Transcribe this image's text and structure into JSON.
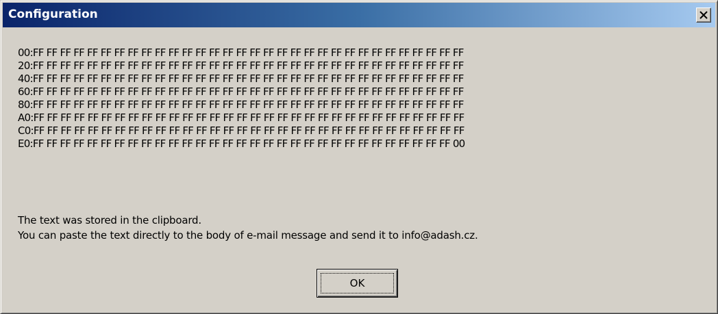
{
  "window": {
    "title": "Configuration",
    "close_symbol": "close-icon"
  },
  "hex_dump": {
    "rows": [
      "00:FF FF FF FF FF FF FF FF FF FF FF FF FF FF FF FF FF FF FF FF FF FF FF FF FF FF FF FF FF FF FF FF",
      "20:FF FF FF FF FF FF FF FF FF FF FF FF FF FF FF FF FF FF FF FF FF FF FF FF FF FF FF FF FF FF FF FF",
      "40:FF FF FF FF FF FF FF FF FF FF FF FF FF FF FF FF FF FF FF FF FF FF FF FF FF FF FF FF FF FF FF FF",
      "60:FF FF FF FF FF FF FF FF FF FF FF FF FF FF FF FF FF FF FF FF FF FF FF FF FF FF FF FF FF FF FF FF",
      "80:FF FF FF FF FF FF FF FF FF FF FF FF FF FF FF FF FF FF FF FF FF FF FF FF FF FF FF FF FF FF FF FF",
      "A0:FF FF FF FF FF FF FF FF FF FF FF FF FF FF FF FF FF FF FF FF FF FF FF FF FF FF FF FF FF FF FF FF",
      "C0:FF FF FF FF FF FF FF FF FF FF FF FF FF FF FF FF FF FF FF FF FF FF FF FF FF FF FF FF FF FF FF FF",
      "E0:FF FF FF FF FF FF FF FF FF FF FF FF FF FF FF FF FF FF FF FF FF FF FF FF FF FF FF FF FF FF FF 00"
    ]
  },
  "message": {
    "line1": "The text was stored in the clipboard.",
    "line2": "You can paste the text directly to the body of e-mail message and send it to info@adash.cz."
  },
  "buttons": {
    "ok_label": "OK"
  },
  "colors": {
    "titlebar_start": "#0a246a",
    "titlebar_end": "#a6caf0",
    "window_background": "#d4d0c8"
  }
}
